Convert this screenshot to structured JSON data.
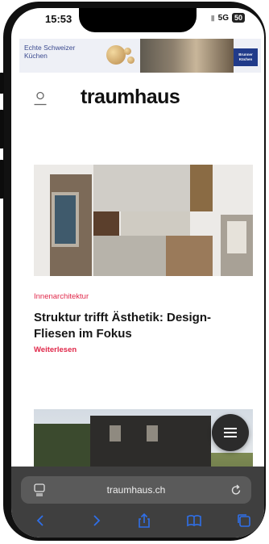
{
  "status": {
    "time": "15:53",
    "network": "5G",
    "battery": "50"
  },
  "ad": {
    "line1": "Echte Schweizer",
    "line2": "Küchen",
    "logo_line1": "Brunner",
    "logo_line2": "Küchen"
  },
  "site": {
    "logo": "traumhaus"
  },
  "article": {
    "category": "Innenarchitektur",
    "title": "Struktur trifft Ästhetik: Design-Fliesen im Fokus",
    "read_more": "Weiterlesen"
  },
  "browser": {
    "url": "traumhaus.ch"
  },
  "icons": [
    "user-icon",
    "menu-icon",
    "page-menu-icon",
    "reload-icon",
    "back-icon",
    "forward-icon",
    "share-icon",
    "bookmarks-icon",
    "tabs-icon"
  ],
  "colors": {
    "accent": "#e0284a",
    "toolbar_icon": "#2f6fe8"
  }
}
